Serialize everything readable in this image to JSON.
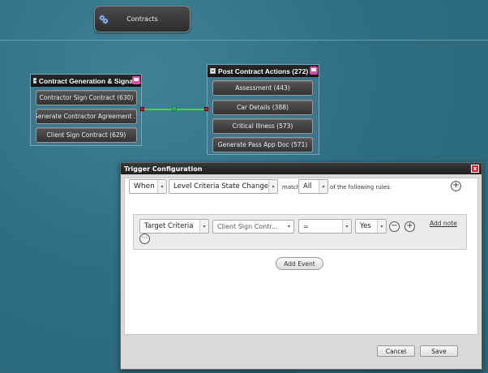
{
  "canvas": {
    "top_node": {
      "label": "Contracts",
      "icon": "gears-icon"
    }
  },
  "left_group": {
    "title": "Contract Generation & Signat...",
    "nodes": [
      {
        "label": "Contractor Sign Contract (630)"
      },
      {
        "label": "Generate Contractor Agreement ..."
      },
      {
        "label": "Client Sign Contract (629)"
      }
    ]
  },
  "right_group": {
    "title": "Post Contract Actions (272)",
    "nodes": [
      {
        "label": "Assessment (443)"
      },
      {
        "label": "Car Details (388)"
      },
      {
        "label": "Critical Illness (573)"
      },
      {
        "label": "Generate Pass App Doc (571)"
      }
    ]
  },
  "dialog": {
    "title": "Trigger Configuration",
    "close_glyph": "x",
    "trigger": {
      "when_value": "When",
      "event_value": "Level Criteria State Changed",
      "match_label": "match",
      "match_value": "All",
      "rules_label": "of the following rules:"
    },
    "rule": {
      "field_value": "Target Criteria",
      "criteria_value": "Client Sign Contr...",
      "operator_value": "=",
      "value_value": "Yes",
      "add_note_label": "Add note"
    },
    "add_event_label": "Add Event",
    "cancel_label": "Cancel",
    "save_label": "Save"
  },
  "colors": {
    "connector": "#4bd23b",
    "port": "#d62020",
    "close_button": "#d2232a",
    "group_badge": "#e04aa8"
  }
}
